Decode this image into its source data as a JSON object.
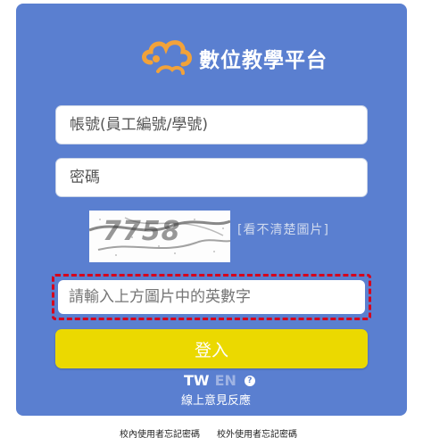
{
  "brand": {
    "title": "數位教學平台",
    "logo_icon": "cloud-logo-icon"
  },
  "form": {
    "account_placeholder": "帳號(員工編號/學號)",
    "password_placeholder": "密碼",
    "captcha_code": "7758",
    "captcha_refresh_label": "[看不清楚圖片]",
    "captcha_placeholder": "請輸入上方圖片中的英數字",
    "login_label": "登入"
  },
  "lang": {
    "tw": "TW",
    "en": "EN",
    "help_icon": "question-circle-icon"
  },
  "feedback_label": "線上意見反應",
  "footer": {
    "forgot_in": "校內使用者忘記密碼",
    "forgot_out": "校外使用者忘記密碼"
  },
  "colors": {
    "panel": "#5a7fd0",
    "login_button": "#ebd900",
    "captcha_highlight": "#d6001c"
  }
}
